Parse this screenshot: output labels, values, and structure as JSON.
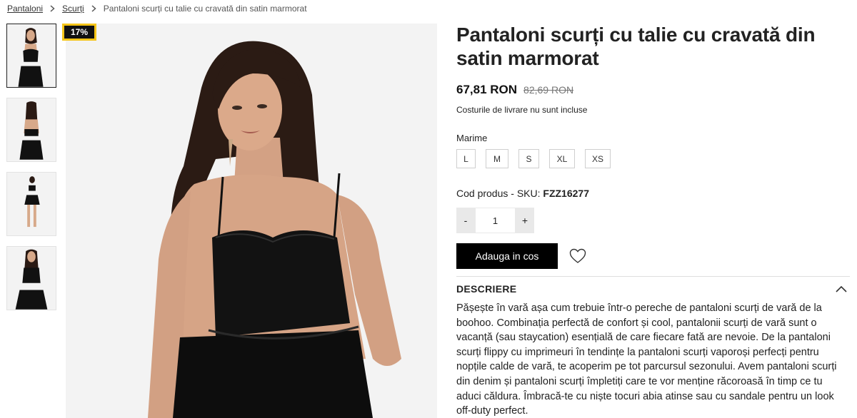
{
  "breadcrumb": {
    "items": [
      "Pantaloni",
      "Scurți"
    ],
    "current": "Pantaloni scurți cu talie cu cravată din satin marmorat"
  },
  "badge": {
    "discount": "17%"
  },
  "product": {
    "title": "Pantaloni scurți cu talie cu cravată din satin marmorat",
    "price": "67,81 RON",
    "old_price": "82,69 RON",
    "shipping": "Costurile de livrare nu sunt incluse",
    "size_label": "Marime",
    "sizes": [
      "L",
      "M",
      "S",
      "XL",
      "XS"
    ],
    "sku_label": "Cod produs - SKU:",
    "sku_value": "FZZ16277",
    "quantity": {
      "minus": "-",
      "value": "1",
      "plus": "+"
    },
    "add_to_cart": "Adauga in cos",
    "description_title": "DESCRIERE",
    "description": "Pășește în vară așa cum trebuie într-o pereche de pantaloni scurți de vară de la boohoo. Combinația perfectă de confort și cool, pantalonii scurți de vară sunt o vacanță (sau staycation) esențială de care fiecare fată are nevoie. De la pantaloni scurți flippy cu imprimeuri în tendințe la pantaloni scurți vaporoși perfecți pentru nopțile calde de vară, te acoperim pe tot parcursul sezonului. Avem pantaloni scurți din denim și pantaloni scurți împletiți care te vor menține răcoroasă în timp ce tu aduci căldura. Îmbracă-te cu niște tocuri abia atinse sau cu sandale pentru un look off-duty perfect."
  },
  "colors": {
    "accent_badge_border": "#f5c518",
    "button_bg": "#000000"
  },
  "icons": {
    "breadcrumb_separator": "chevron-right-icon",
    "wishlist": "heart-icon",
    "collapse": "chevron-up-icon"
  }
}
